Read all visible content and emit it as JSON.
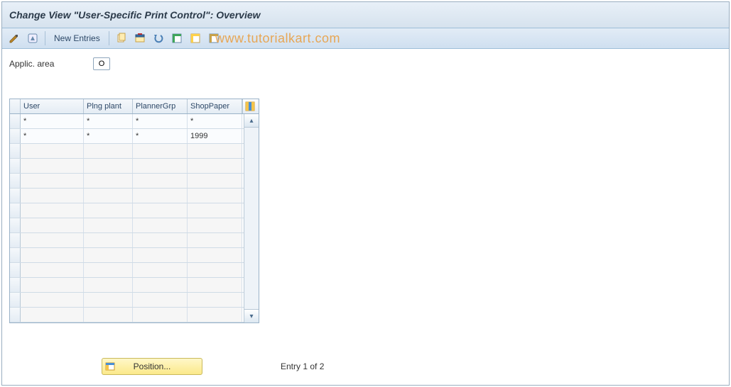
{
  "title": "Change View \"User-Specific Print Control\": Overview",
  "watermark": "www.tutorialkart.com",
  "toolbar": {
    "new_entries_label": "New Entries"
  },
  "fields": {
    "applic_area_label": "Applic. area",
    "applic_area_value": "O"
  },
  "table": {
    "headers": {
      "user": "User",
      "plng_plant": "Plng plant",
      "planner_grp": "PlannerGrp",
      "shop_paper": "ShopPaper"
    },
    "rows": [
      {
        "user": "*",
        "plng_plant": "*",
        "planner_grp": "*",
        "shop_paper": "*"
      },
      {
        "user": "*",
        "plng_plant": "*",
        "planner_grp": "*",
        "shop_paper": "1999"
      }
    ],
    "empty_row_count": 12
  },
  "footer": {
    "position_label": "Position...",
    "entry_status": "Entry 1 of 2"
  }
}
